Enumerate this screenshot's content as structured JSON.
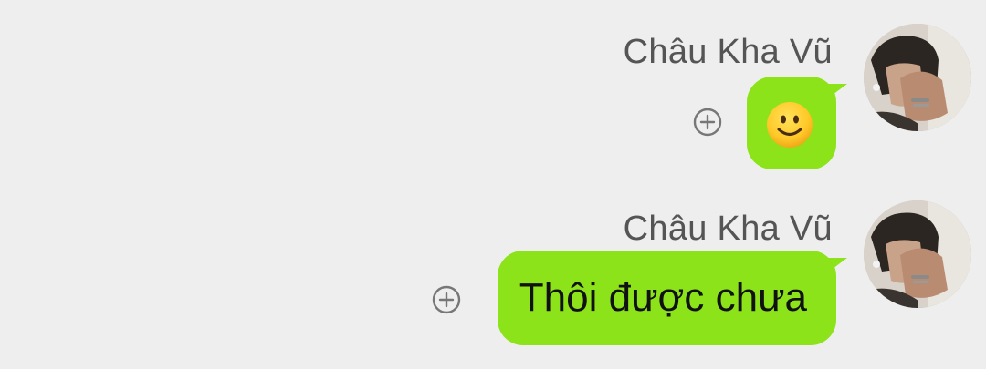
{
  "messages": [
    {
      "sender": "Châu Kha Vũ",
      "type": "emoji",
      "emoji_icon": "slightly-smiling-face-icon"
    },
    {
      "sender": "Châu Kha Vũ",
      "type": "text",
      "text": "Thôi được chưa"
    }
  ],
  "colors": {
    "background": "#eeeeee",
    "bubble": "#8de31a",
    "sender_name": "#555555",
    "message_text": "#111111",
    "react_icon": "#777777"
  }
}
